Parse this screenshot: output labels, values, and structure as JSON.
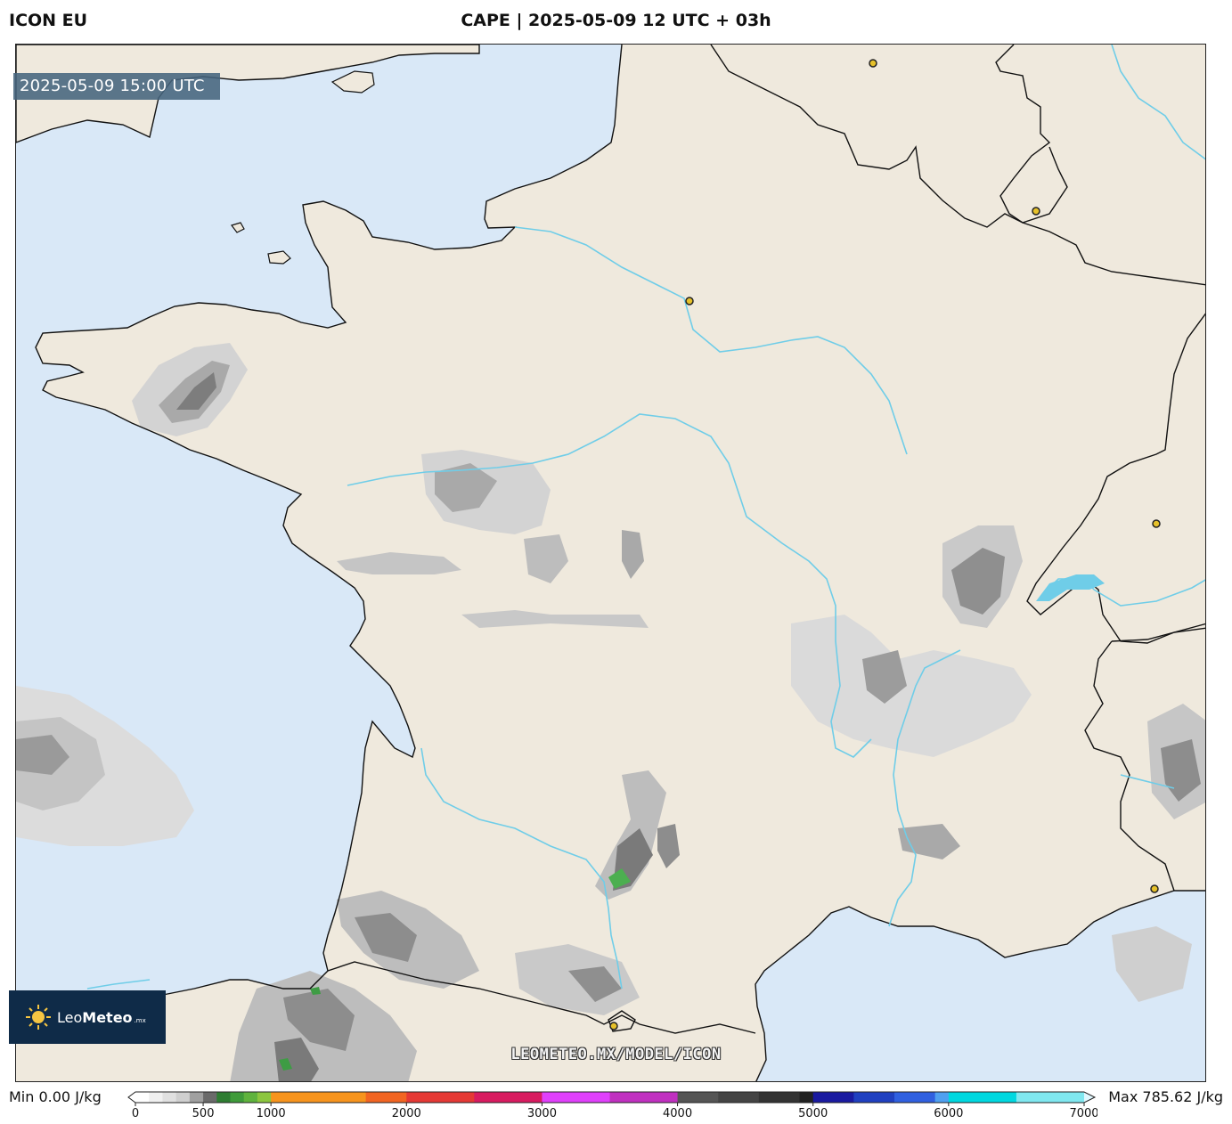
{
  "header": {
    "model": "ICON EU",
    "title": "CAPE | 2025-05-09 12 UTC + 03h"
  },
  "map": {
    "valid_time": "2025-05-09 15:00 UTC",
    "watermark": "LEOMETEO.MX/MODEL/ICON",
    "colors": {
      "sea": "#d9e8f7",
      "land": "#efe9dd",
      "river": "#6fcde8",
      "border": "#111111",
      "city": "#e6c12a"
    }
  },
  "logo": {
    "name_part1": "Leo",
    "name_part2": "Meteo",
    "suffix": ".mx",
    "icon": "sun-icon"
  },
  "colorbar": {
    "min_label": "Min 0.00 J/kg",
    "max_label": "Max 785.62 J/kg",
    "unit": "J/kg",
    "ticks": [
      "0",
      "500",
      "1000",
      "2000",
      "3000",
      "4000",
      "5000",
      "6000",
      "7000"
    ]
  }
}
